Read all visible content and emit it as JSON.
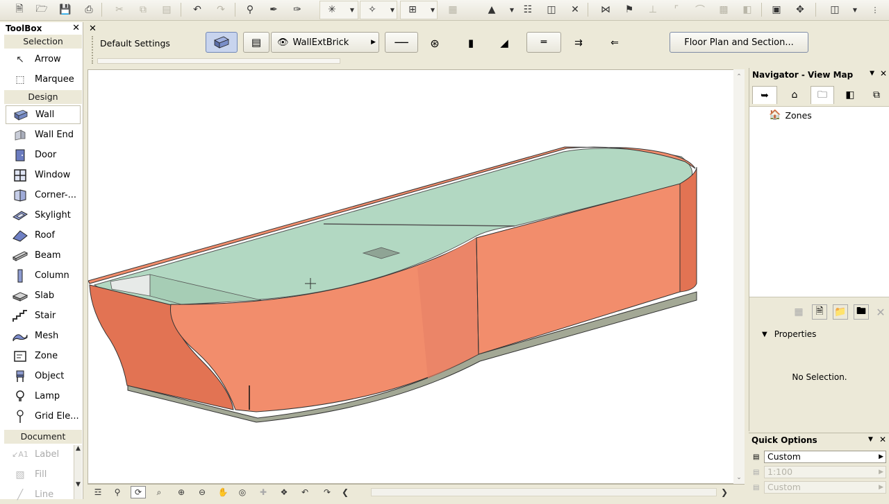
{
  "toolbar": {
    "icons": [
      "new-icon",
      "open-icon",
      "save-icon",
      "print-icon",
      "cut-icon",
      "copy-icon",
      "paste-icon",
      "undo-icon",
      "redo-icon",
      "find-icon",
      "eyedropper-icon",
      "syringe-icon",
      "gravity-icon",
      "magic-wand-icon",
      "grid-snap-icon",
      "trace-icon",
      "layers-icon",
      "ruler-icon",
      "close-icon",
      "trim-icon",
      "split-icon",
      "adjust-icon",
      "fillet-icon",
      "curve-icon",
      "offset-icon",
      "explode-icon",
      "plan-view-icon",
      "3d-view-icon",
      "window-icon"
    ]
  },
  "toolbox": {
    "title": "ToolBox",
    "sections": {
      "selection": "Selection",
      "design": "Design",
      "document": "Document"
    },
    "selection_tools": [
      {
        "label": "Arrow",
        "icon": "arrow-icon"
      },
      {
        "label": "Marquee",
        "icon": "marquee-icon"
      }
    ],
    "design_tools": [
      {
        "label": "Wall",
        "icon": "wall-icon"
      },
      {
        "label": "Wall End",
        "icon": "wall-end-icon"
      },
      {
        "label": "Door",
        "icon": "door-icon"
      },
      {
        "label": "Window",
        "icon": "window-icon"
      },
      {
        "label": "Corner-...",
        "icon": "corner-window-icon"
      },
      {
        "label": "Skylight",
        "icon": "skylight-icon"
      },
      {
        "label": "Roof",
        "icon": "roof-icon"
      },
      {
        "label": "Beam",
        "icon": "beam-icon"
      },
      {
        "label": "Column",
        "icon": "column-icon"
      },
      {
        "label": "Slab",
        "icon": "slab-icon"
      },
      {
        "label": "Stair",
        "icon": "stair-icon"
      },
      {
        "label": "Mesh",
        "icon": "mesh-icon"
      },
      {
        "label": "Zone",
        "icon": "zone-icon"
      },
      {
        "label": "Object",
        "icon": "object-icon"
      },
      {
        "label": "Lamp",
        "icon": "lamp-icon"
      },
      {
        "label": "Grid Ele...",
        "icon": "grid-element-icon"
      }
    ],
    "document_tools": [
      {
        "label": "Label",
        "icon": "label-icon"
      },
      {
        "label": "Fill",
        "icon": "fill-icon"
      },
      {
        "label": "Line",
        "icon": "line-icon"
      }
    ],
    "selected": "Wall"
  },
  "infobox": {
    "default_settings": "Default Settings",
    "composite": "WallExtBrick",
    "floor_plan_button": "Floor Plan and Section..."
  },
  "navigator": {
    "title": "Navigator - View Map",
    "tree_item": "Zones",
    "properties_label": "Properties",
    "no_selection": "No Selection."
  },
  "quick_options": {
    "title": "Quick Options",
    "layer_combination": "Custom",
    "scale": "1:100",
    "dimension": "Custom"
  },
  "colors": {
    "wall_outer": "#f28d6c",
    "wall_inner": "#e27353",
    "floor": "#b2d8c2",
    "slab_edge": "#a3a895"
  }
}
